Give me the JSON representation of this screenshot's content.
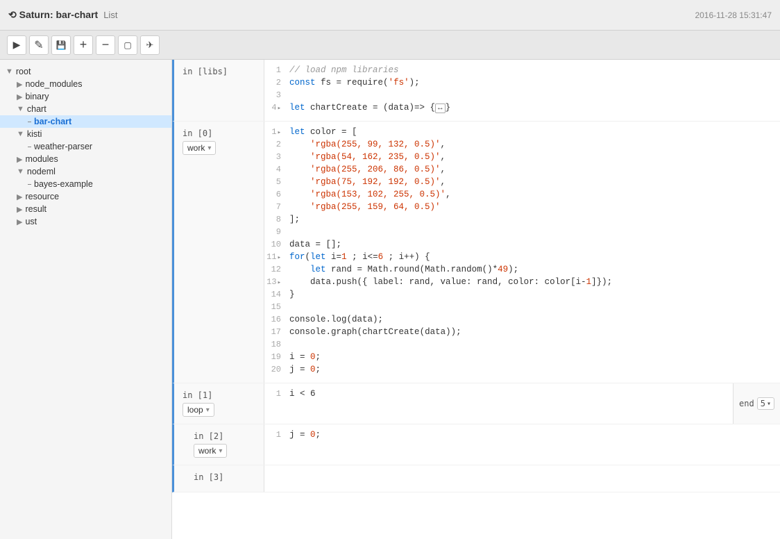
{
  "topbar": {
    "logo": "⟲ Saturn: bar-chart",
    "list_label": "List",
    "timestamp": "2016-11-28 15:31:47"
  },
  "toolbar": {
    "buttons": [
      {
        "name": "run-button",
        "icon": "▶",
        "label": "Run"
      },
      {
        "name": "edit-button",
        "icon": "✎",
        "label": "Edit"
      },
      {
        "name": "save-button",
        "icon": "💾",
        "label": "Save"
      },
      {
        "name": "add-button",
        "icon": "+",
        "label": "Add"
      },
      {
        "name": "remove-button",
        "icon": "−",
        "label": "Remove"
      },
      {
        "name": "clear-button",
        "icon": "☐",
        "label": "Clear"
      },
      {
        "name": "bookmark-button",
        "icon": "✈",
        "label": "Bookmark"
      }
    ]
  },
  "sidebar": {
    "items": [
      {
        "id": "root",
        "label": "root",
        "type": "folder",
        "depth": 0
      },
      {
        "id": "node_modules",
        "label": "node_modules",
        "type": "folder",
        "depth": 1
      },
      {
        "id": "binary",
        "label": "binary",
        "type": "folder",
        "depth": 1
      },
      {
        "id": "chart",
        "label": "chart",
        "type": "folder",
        "depth": 1
      },
      {
        "id": "bar-chart",
        "label": "bar-chart",
        "type": "file",
        "depth": 2,
        "active": true
      },
      {
        "id": "kisti",
        "label": "kisti",
        "type": "folder",
        "depth": 1
      },
      {
        "id": "weather-parser",
        "label": "weather-parser",
        "type": "file",
        "depth": 2
      },
      {
        "id": "modules",
        "label": "modules",
        "type": "folder",
        "depth": 1
      },
      {
        "id": "nodeml",
        "label": "nodeml",
        "type": "folder",
        "depth": 1
      },
      {
        "id": "bayes-example",
        "label": "bayes-example",
        "type": "file",
        "depth": 2
      },
      {
        "id": "resource",
        "label": "resource",
        "type": "folder",
        "depth": 1
      },
      {
        "id": "result",
        "label": "result",
        "type": "folder",
        "depth": 1
      },
      {
        "id": "ust",
        "label": "ust",
        "type": "folder",
        "depth": 1
      }
    ]
  },
  "cells": [
    {
      "id": "libs",
      "label": "in [libs]",
      "badge": null,
      "end_label": null,
      "end_badge": null,
      "lines": [
        {
          "num": 1,
          "code": "// load npm libraries",
          "type": "comment"
        },
        {
          "num": 2,
          "code": "const fs = require('fs');",
          "type": "code"
        },
        {
          "num": 3,
          "code": "",
          "type": "code"
        },
        {
          "num": 4,
          "code": "let chartCreate = (data)=> {↔}",
          "type": "code",
          "fold": true
        }
      ]
    },
    {
      "id": "0",
      "label": "in [0]",
      "badge": "work",
      "end_label": null,
      "end_badge": null,
      "lines": [
        {
          "num": 1,
          "code": "let color = [",
          "type": "code",
          "fold": true
        },
        {
          "num": 2,
          "code": "    'rgba(255, 99, 132, 0.5)',",
          "type": "string"
        },
        {
          "num": 3,
          "code": "    'rgba(54, 162, 235, 0.5)',",
          "type": "string"
        },
        {
          "num": 4,
          "code": "    'rgba(255, 206, 86, 0.5)',",
          "type": "string"
        },
        {
          "num": 5,
          "code": "    'rgba(75, 192, 192, 0.5)',",
          "type": "string"
        },
        {
          "num": 6,
          "code": "    'rgba(153, 102, 255, 0.5)',",
          "type": "string"
        },
        {
          "num": 7,
          "code": "    'rgba(255, 159, 64, 0.5)'",
          "type": "string"
        },
        {
          "num": 8,
          "code": "];",
          "type": "code"
        },
        {
          "num": 9,
          "code": "",
          "type": "code"
        },
        {
          "num": 10,
          "code": "data = [];",
          "type": "code"
        },
        {
          "num": 11,
          "code": "for(let i=1 ; i<=6 ; i++) {",
          "type": "code",
          "fold": true
        },
        {
          "num": 12,
          "code": "    let rand = Math.round(Math.random()*49);",
          "type": "code"
        },
        {
          "num": 13,
          "code": "    data.push({ label: rand, value: rand, color: color[i-1]});",
          "type": "code",
          "fold": true
        },
        {
          "num": 14,
          "code": "}",
          "type": "code"
        },
        {
          "num": 15,
          "code": "",
          "type": "code"
        },
        {
          "num": 16,
          "code": "console.log(data);",
          "type": "code"
        },
        {
          "num": 17,
          "code": "console.graph(chartCreate(data));",
          "type": "code"
        },
        {
          "num": 18,
          "code": "",
          "type": "code"
        },
        {
          "num": 19,
          "code": "i = 0;",
          "type": "code"
        },
        {
          "num": 20,
          "code": "j = 0;",
          "type": "code"
        }
      ]
    },
    {
      "id": "1",
      "label": "in [1]",
      "badge": "loop",
      "end_label": "end",
      "end_badge": "5",
      "lines": [
        {
          "num": 1,
          "code": "i < 6",
          "type": "code"
        }
      ]
    },
    {
      "id": "2",
      "label": "in [2]",
      "badge": "work",
      "end_label": null,
      "end_badge": null,
      "lines": [
        {
          "num": 1,
          "code": "j = 0;",
          "type": "code"
        }
      ],
      "indent": 1
    },
    {
      "id": "3",
      "label": "in [3]",
      "badge": null,
      "end_label": null,
      "end_badge": null,
      "lines": [],
      "indent": 1
    }
  ]
}
